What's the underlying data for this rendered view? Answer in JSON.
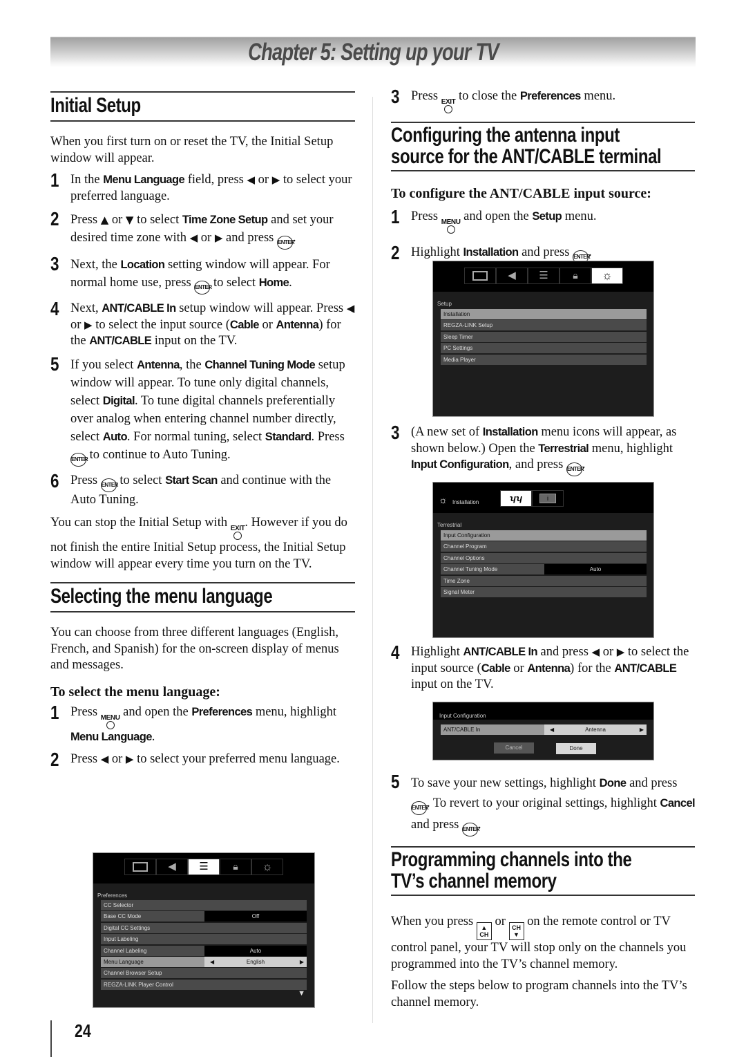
{
  "chapter_title": "Chapter 5: Setting up your TV",
  "page_number": "24",
  "initial_setup": {
    "heading": "Initial Setup",
    "intro": "When you first turn on or reset the TV, the Initial Setup window will appear.",
    "steps": [
      {
        "num": "1",
        "parts": [
          "In the ",
          "Menu Language",
          " field, press ",
          "◀",
          " or ",
          "▶",
          " to select your preferred language."
        ]
      },
      {
        "num": "2",
        "parts": [
          "Press ",
          "▲",
          " or ",
          "▼",
          " to select ",
          "Time Zone Setup",
          " and set your desired time zone with ",
          "◀",
          " or ",
          "▶",
          " and press ",
          "ENTER",
          "."
        ]
      },
      {
        "num": "3",
        "parts": [
          "Next, the ",
          "Location",
          " setting window will appear. For normal home use, press ",
          "ENTER",
          " to select ",
          "Home",
          "."
        ]
      },
      {
        "num": "4",
        "parts": [
          "Next, ",
          "ANT/CABLE In",
          " setup window will appear. Press ",
          "◀",
          " or ",
          "▶",
          " to select the input source (",
          "Cable",
          " or ",
          "Antenna",
          ") for the ",
          "ANT/CABLE",
          " input on the TV."
        ]
      },
      {
        "num": "5",
        "parts": [
          "If you select ",
          "Antenna",
          ", the ",
          "Channel Tuning Mode",
          " setup window will appear. To tune only digital channels, select ",
          "Digital",
          ". To tune digital channels preferentially over analog when entering channel number directly, select ",
          "Auto",
          ". For normal tuning, select ",
          "Standard",
          ". Press ",
          "ENTER",
          " to continue to Auto Tuning."
        ]
      },
      {
        "num": "6",
        "parts": [
          "Press ",
          "ENTER",
          " to select ",
          "Start Scan",
          " and continue with the Auto Tuning."
        ]
      }
    ],
    "note_a": "You can stop the Initial Setup with ",
    "note_btn": "EXIT",
    "note_b": ". However if you do not finish the entire Initial Setup process, the Initial Setup window will appear every time you turn on the TV."
  },
  "menu_language": {
    "heading": "Selecting the menu language",
    "intro": "You can choose from three different languages (English, French, and Spanish) for the on-screen display of menus and messages.",
    "subheading": "To select the menu language:",
    "step1_a": "Press ",
    "step1_btn": "MENU",
    "step1_b": " and open the ",
    "step1_bold1": "Preferences",
    "step1_c": " menu, highlight ",
    "step1_bold2": "Menu Language",
    "step1_d": ".",
    "step2_a": "Press ",
    "step2_b": " or ",
    "step2_c": " to select your preferred menu language.",
    "step3_a": "Press ",
    "step3_btn": "EXIT",
    "step3_b": " to close the ",
    "step3_bold": "Preferences",
    "step3_c": " menu."
  },
  "preferences_osd": {
    "tabs": [
      "picture-icon",
      "audio-icon",
      "preferences-icon",
      "lock-icon",
      "setup-icon"
    ],
    "active_tab": "preferences-icon",
    "title": "Preferences",
    "rows": [
      {
        "label": "CC Selector",
        "value": null,
        "highlight": false
      },
      {
        "label": "Base CC Mode",
        "value": "Off",
        "highlight": false
      },
      {
        "label": "Digital CC Settings",
        "value": null,
        "highlight": false
      },
      {
        "label": "Input Labeling",
        "value": null,
        "highlight": false
      },
      {
        "label": "Channel Labeling",
        "value": "Auto",
        "highlight": false
      },
      {
        "label": "Menu Language",
        "value": "English",
        "highlight": true,
        "arrows": true
      },
      {
        "label": "Channel Browser Setup",
        "value": null,
        "highlight": false
      },
      {
        "label": "REGZA-LINK Player Control",
        "value": null,
        "highlight": false
      }
    ],
    "more_indicator": "▼"
  },
  "antenna": {
    "heading_line1": "Configuring the antenna input",
    "heading_line2": "source for the ANT/CABLE terminal",
    "subheading": "To configure the ANT/CABLE input source:",
    "step1_a": "Press ",
    "step1_btn": "MENU",
    "step1_b": " and open the ",
    "step1_bold": "Setup",
    "step1_c": " menu.",
    "step2_a": "Highlight ",
    "step2_bold": "Installation",
    "step2_b": " and press ",
    "step3_a": "(A new set of ",
    "step3_bold1": "Installation",
    "step3_b": " menu icons will appear, as shown below.) Open the ",
    "step3_bold2": "Terrestrial",
    "step3_c": " menu, highlight ",
    "step3_bold3": "Input Configuration",
    "step3_d": ", and press ",
    "step4_a": "Highlight ",
    "step4_bold1": "ANT/CABLE In",
    "step4_b": " and press ",
    "step4_c": " or ",
    "step4_d": " to select the input source (",
    "step4_bold2": "Cable",
    "step4_e": " or ",
    "step4_bold3": "Antenna",
    "step4_f": ") for the ",
    "step4_bold4": "ANT/CABLE",
    "step4_g": " input on the TV.",
    "step5_a": "To save your new settings, highlight ",
    "step5_bold1": "Done",
    "step5_b": " and press ",
    "step5_c": ". To revert to your original settings, highlight ",
    "step5_bold2": "Cancel",
    "step5_d": " and press ",
    "step5_e": "."
  },
  "setup_osd": {
    "tabs": [
      "picture-icon",
      "audio-icon",
      "preferences-icon",
      "lock-icon",
      "setup-icon"
    ],
    "active_tab": "setup-icon",
    "title": "Setup",
    "rows": [
      {
        "label": "Installation",
        "highlight": true
      },
      {
        "label": "REGZA-LINK Setup",
        "highlight": false
      },
      {
        "label": "Sleep Timer",
        "highlight": false
      },
      {
        "label": "PC Settings",
        "highlight": false
      },
      {
        "label": "Media Player",
        "highlight": false
      }
    ]
  },
  "installation_osd": {
    "header_label": "Installation",
    "tabs": [
      "antenna-icon",
      "info-icon"
    ],
    "active_tab": "antenna-icon",
    "title": "Terrestrial",
    "rows": [
      {
        "label": "Input Configuration",
        "value": null,
        "highlight": true
      },
      {
        "label": "Channel Program",
        "value": null,
        "highlight": false
      },
      {
        "label": "Channel Options",
        "value": null,
        "highlight": false
      },
      {
        "label": "Channel Tuning Mode",
        "value": "Auto",
        "highlight": false
      },
      {
        "label": "Time Zone",
        "value": null,
        "highlight": false
      },
      {
        "label": "Signal Meter",
        "value": null,
        "highlight": false
      }
    ]
  },
  "input_config_osd": {
    "title": "Input Configuration",
    "row_label": "ANT/CABLE In",
    "row_value": "Antenna",
    "cancel_label": "Cancel",
    "done_label": "Done"
  },
  "programming": {
    "heading_line1": "Programming channels into the",
    "heading_line2": "TV’s channel memory",
    "para1_a": "When you press ",
    "ch_up_label": "CH",
    "para1_b": " or ",
    "ch_down_label": "CH",
    "para1_c": " on the remote control or TV control panel, your TV will stop only on the channels you programmed into the TV’s channel memory.",
    "para2": "Follow the steps below to program channels into the TV’s channel memory."
  }
}
